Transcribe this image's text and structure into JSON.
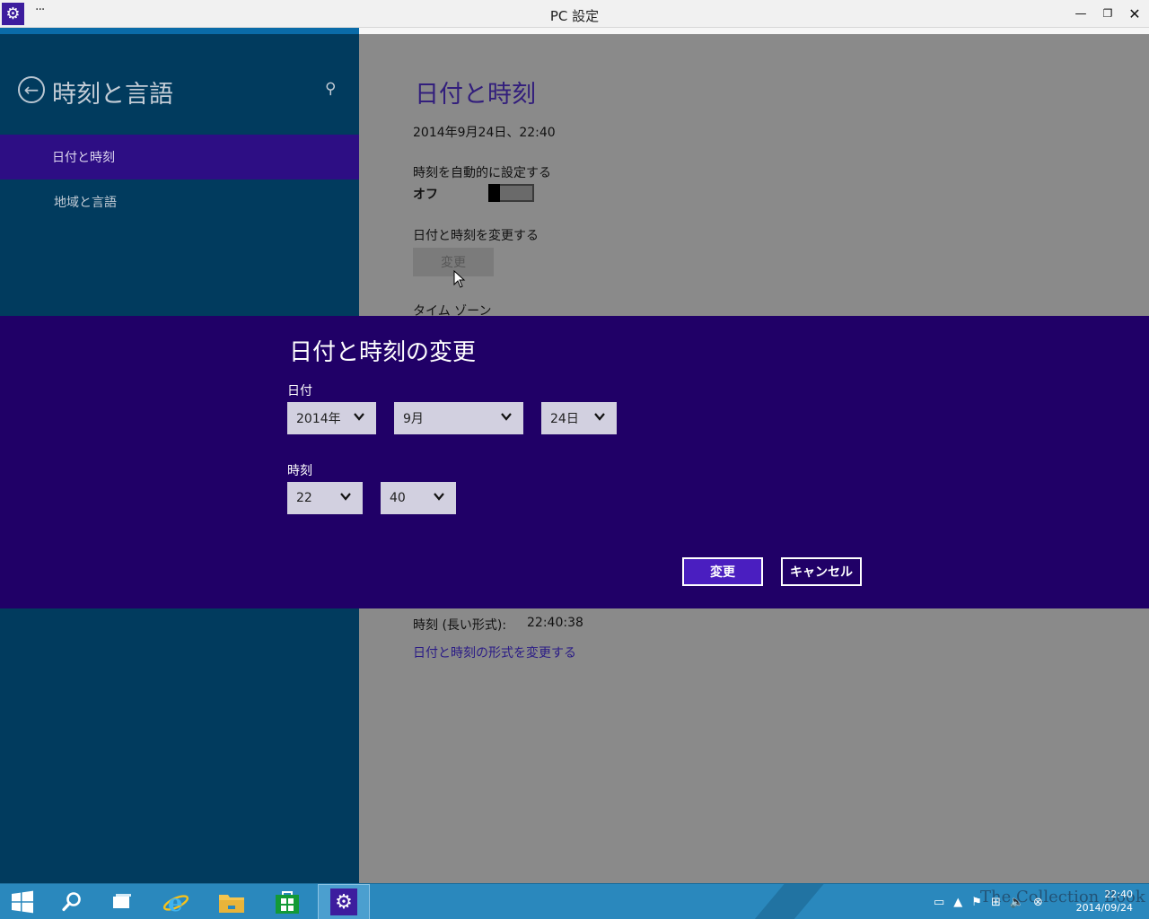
{
  "window": {
    "title": "PC 設定",
    "menu_label": "···",
    "minimize_glyph": "—",
    "maximize_glyph": "❐",
    "close_glyph": "✕"
  },
  "left_pane": {
    "section_title": "時刻と言語",
    "nav_items": [
      {
        "label": "日付と時刻",
        "selected": true
      },
      {
        "label": "地域と言語",
        "selected": false
      }
    ]
  },
  "main": {
    "page_title": "日付と時刻",
    "current_datetime": "2014年9月24日、22:40",
    "auto_time_label": "時刻を自動的に設定する",
    "auto_time_state": "オフ",
    "change_label": "日付と時刻を変更する",
    "change_button": "変更",
    "timezone_label": "タイム ゾーン",
    "long_time_label": "時刻 (長い形式):",
    "long_time_value": "22:40:38",
    "format_link": "日付と時刻の形式を変更する"
  },
  "dialog": {
    "title": "日付と時刻の変更",
    "date_label": "日付",
    "year": "2014年",
    "month": "9月",
    "day": "24日",
    "time_label": "時刻",
    "hour": "22",
    "minute": "40",
    "ok_button": "変更",
    "cancel_button": "キャンセル"
  },
  "taskbar": {
    "watermark": "The Collection Book",
    "clock_time": "22:40",
    "clock_date": "2014/09/24"
  },
  "colors": {
    "dialog_bg": "#200067",
    "left_pane_bg": "#013b5e",
    "accent": "#4a1ec0",
    "taskbar": "#2a88bd"
  }
}
